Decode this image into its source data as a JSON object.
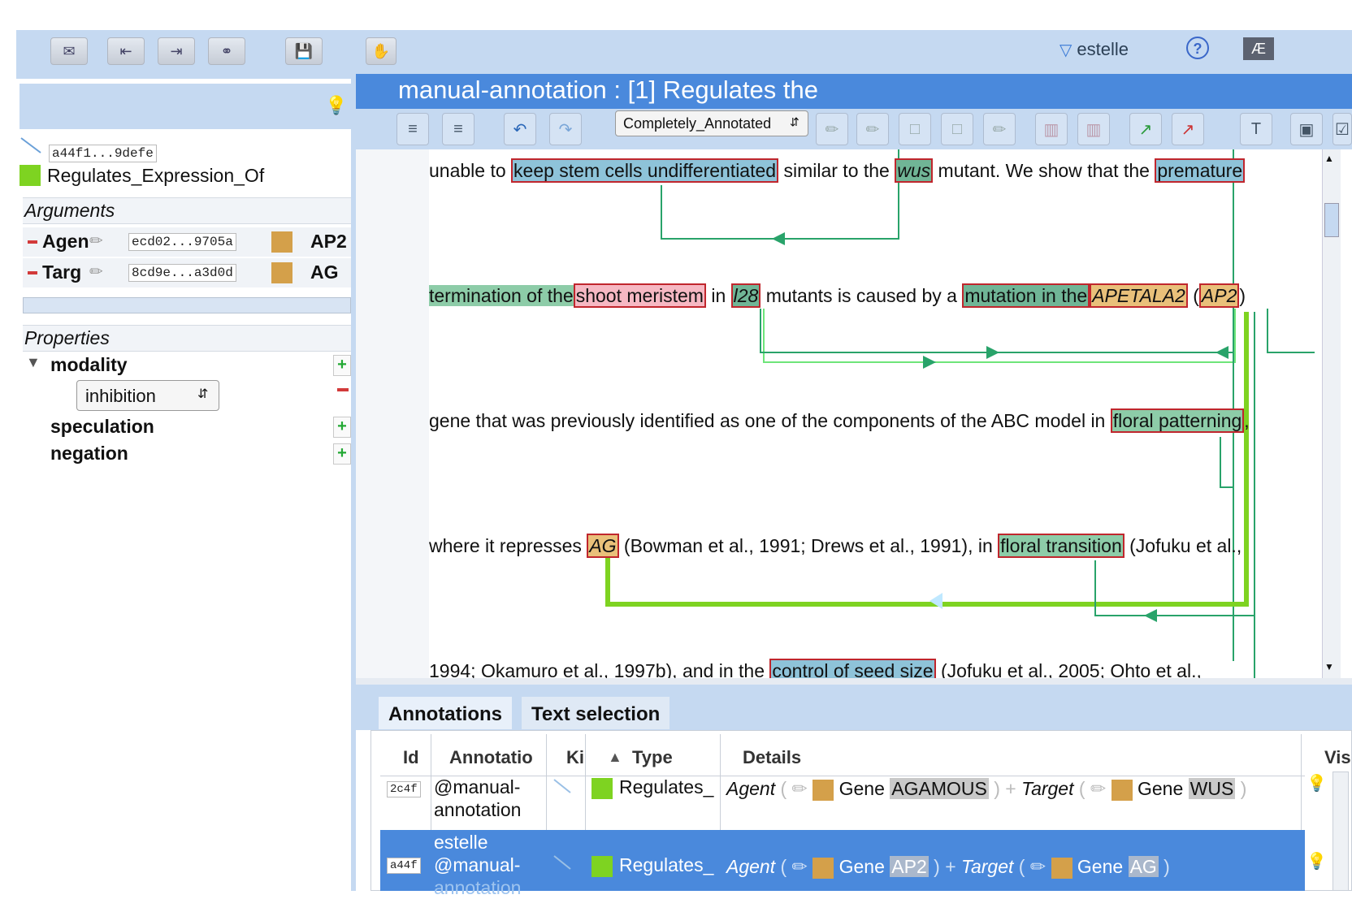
{
  "user": {
    "name": "estelle"
  },
  "toolbar": {
    "icons": [
      "import-icon",
      "nav-previous-icon",
      "nav-next-icon",
      "link-icon",
      "save-icon",
      "handshake-icon"
    ]
  },
  "left": {
    "annotation_id": "a44f1...9defe",
    "relation_type": "Regulates_Expression_Of",
    "relation_color": "#7ed321",
    "arguments_title": "Arguments",
    "arguments": [
      {
        "role": "Agen",
        "id": "ecd02...9705a",
        "value": "AP2",
        "color": "#d4a04a"
      },
      {
        "role": "Targ",
        "id": "8cd9e...a3d0d",
        "value": "AG",
        "color": "#d4a04a"
      }
    ],
    "properties_title": "Properties",
    "properties": {
      "modality": "modality",
      "modality_value": "inhibition",
      "speculation": "speculation",
      "negation": "negation"
    }
  },
  "document": {
    "title": "manual-annotation : [1] Regulates the",
    "status": "Completely_Annotated",
    "lines": {
      "l1": {
        "a": "unable to ",
        "s1": "keep stem cells undifferentiated",
        "b": " similar to the ",
        "s2": "wus",
        "c": " mutant. We show that the ",
        "s3": "premature"
      },
      "l2": {
        "s1": "termination of the",
        "s2": "shoot meristem",
        "a": " in ",
        "s3": "l28",
        "b": " mutants is caused by a ",
        "s4": "mutation in the",
        "s5": "APETALA2",
        "c": " (",
        "s6": "AP2",
        "d": ")"
      },
      "l3": {
        "a": "gene that was previously identified as one of the components of the ABC model in ",
        "s1": "floral patterning",
        "b": ","
      },
      "l4": {
        "a": "where it represses ",
        "s1": "AG",
        "b": " (Bowman et al., 1991; Drews et al., 1991), in ",
        "s2": "floral transition",
        "c": " (Jofuku et al.,"
      },
      "l5": {
        "a": "1994; Okamuro et al., 1997b), and in the ",
        "s1": "control of seed size",
        "b": " (Jofuku et al., 2005; Ohto et al.,"
      }
    }
  },
  "bottom": {
    "tabs": [
      "Annotations",
      "Text selection"
    ],
    "columns": [
      "Id",
      "Annotatio",
      "Ki",
      "Type",
      "Details",
      "Vis"
    ],
    "rows": [
      {
        "id": "2c4f",
        "annotator": "@manual-annotation",
        "annotator_l1": "@manual-",
        "annotator_l2": "annotation",
        "type": "Regulates_",
        "agent_label": "Agent",
        "agent_kind": "Gene",
        "agent_value": "AGAMOUS",
        "plus": "+",
        "target_label": "Target",
        "target_kind": "Gene",
        "target_value": "WUS"
      },
      {
        "id": "a44f",
        "annotator_l0": "estelle",
        "annotator_l1": "@manual-",
        "annotator_l2": "annotation",
        "type": "Regulates_",
        "agent_label": "Agent",
        "agent_kind": "Gene",
        "agent_value": "AP2",
        "plus": "+",
        "target_label": "Target",
        "target_kind": "Gene",
        "target_value": "AG"
      }
    ]
  }
}
